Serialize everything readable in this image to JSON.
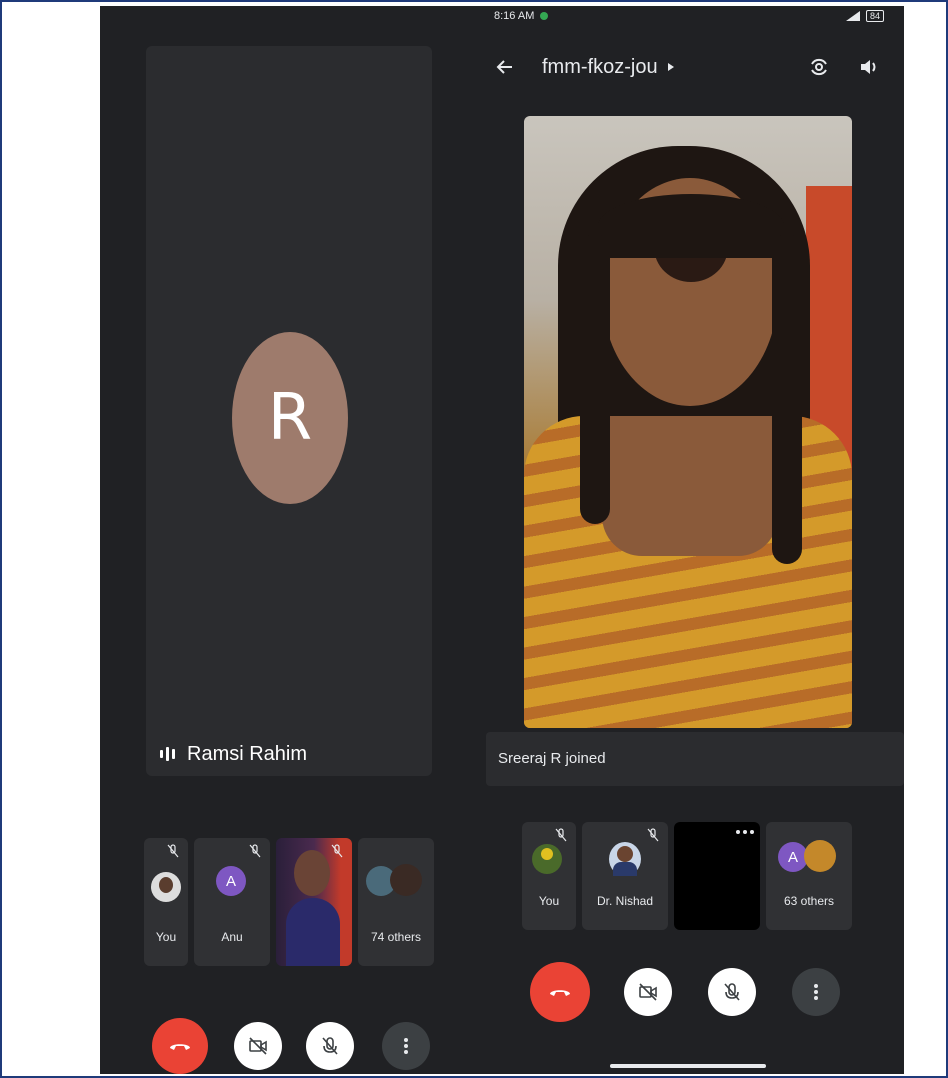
{
  "left_call": {
    "main_speaker": {
      "initial": "R",
      "name": "Ramsi Rahim",
      "avatar_color": "#9e7b6c"
    },
    "participants": [
      {
        "label": "You",
        "kind": "self"
      },
      {
        "label": "Anu",
        "kind": "initial",
        "initial": "A",
        "color": "#7e57c2"
      },
      {
        "label": "",
        "kind": "video"
      },
      {
        "label": "74 others",
        "kind": "others"
      }
    ],
    "controls": [
      "end-call",
      "camera-off",
      "mic-off",
      "more"
    ]
  },
  "right_call": {
    "status_time": "8:16 AM",
    "battery": "84",
    "meeting_code": "fmm-fkoz-jou",
    "banner": "Sreeraj R joined",
    "participants": [
      {
        "label": "You",
        "kind": "self"
      },
      {
        "label": "Dr. Nishad",
        "kind": "photo"
      },
      {
        "label": "",
        "kind": "black"
      },
      {
        "label": "63 others",
        "kind": "others",
        "initial": "A"
      }
    ],
    "controls": [
      "end-call",
      "camera-off",
      "mic-off",
      "more"
    ]
  },
  "colors": {
    "end_call_red": "#ea4335",
    "background_dark": "#202124",
    "tile_dark": "#303134"
  }
}
